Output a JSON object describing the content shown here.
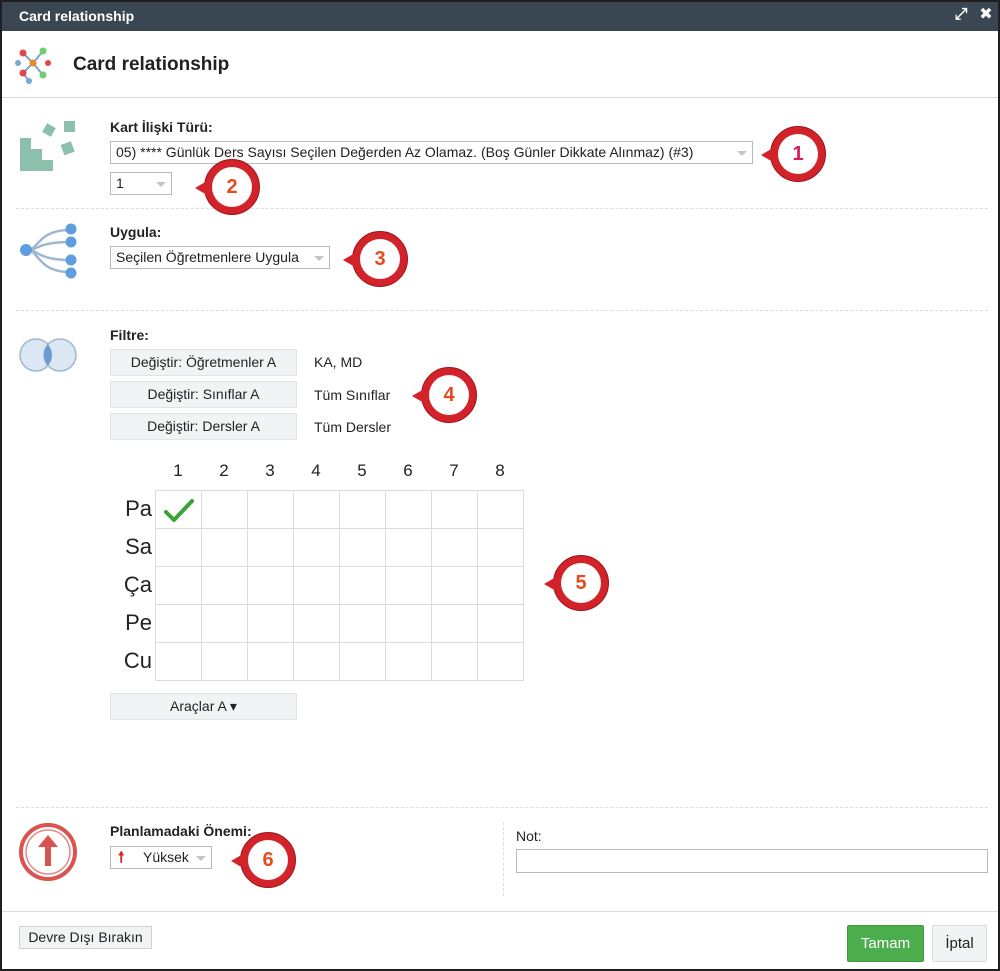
{
  "window": {
    "title": "Card relationship"
  },
  "header": {
    "title": "Card relationship",
    "icon": "card-relationship-icon"
  },
  "card_type": {
    "label": "Kart İlişki Türü:",
    "selected": "05) **** Günlük Ders Sayısı Seçilen Değerden Az Olamaz. (Boş Günler Dikkate Alınmaz) (#3)",
    "value_select": "1"
  },
  "apply": {
    "label": "Uygula:",
    "selected": "Seçilen Öğretmenlere Uygula"
  },
  "filter": {
    "label": "Filtre:",
    "rows": [
      {
        "button": "Değiştir: Öğretmenler A",
        "value": "KA, MD"
      },
      {
        "button": "Değiştir: Sınıflar A",
        "value": "Tüm Sınıflar"
      },
      {
        "button": "Değiştir: Dersler A",
        "value": "Tüm Dersler"
      }
    ]
  },
  "schedule": {
    "columns": [
      "1",
      "2",
      "3",
      "4",
      "5",
      "6",
      "7",
      "8"
    ],
    "rows": [
      "Pa",
      "Sa",
      "Ça",
      "Pe",
      "Cu"
    ],
    "checked": [
      [
        0,
        0
      ]
    ],
    "tools_button": "Araçlar A ▾"
  },
  "importance": {
    "label": "Planlamadaki Önemi:",
    "selected": "Yüksek",
    "icon": "arrow-up-icon"
  },
  "note": {
    "label": "Not:",
    "value": ""
  },
  "footer": {
    "disable_button": "Devre Dışı Bırakın",
    "ok_button": "Tamam",
    "cancel_button": "İptal"
  },
  "callouts": [
    "1",
    "2",
    "3",
    "4",
    "5",
    "6"
  ],
  "colors": {
    "titlebar": "#3a4752",
    "callout_red": "#d2232a",
    "ok_green": "#4cad4c",
    "check_green": "#3aa335",
    "callout_1_text": "#d81b60",
    "callout_text": "#e8491d"
  }
}
